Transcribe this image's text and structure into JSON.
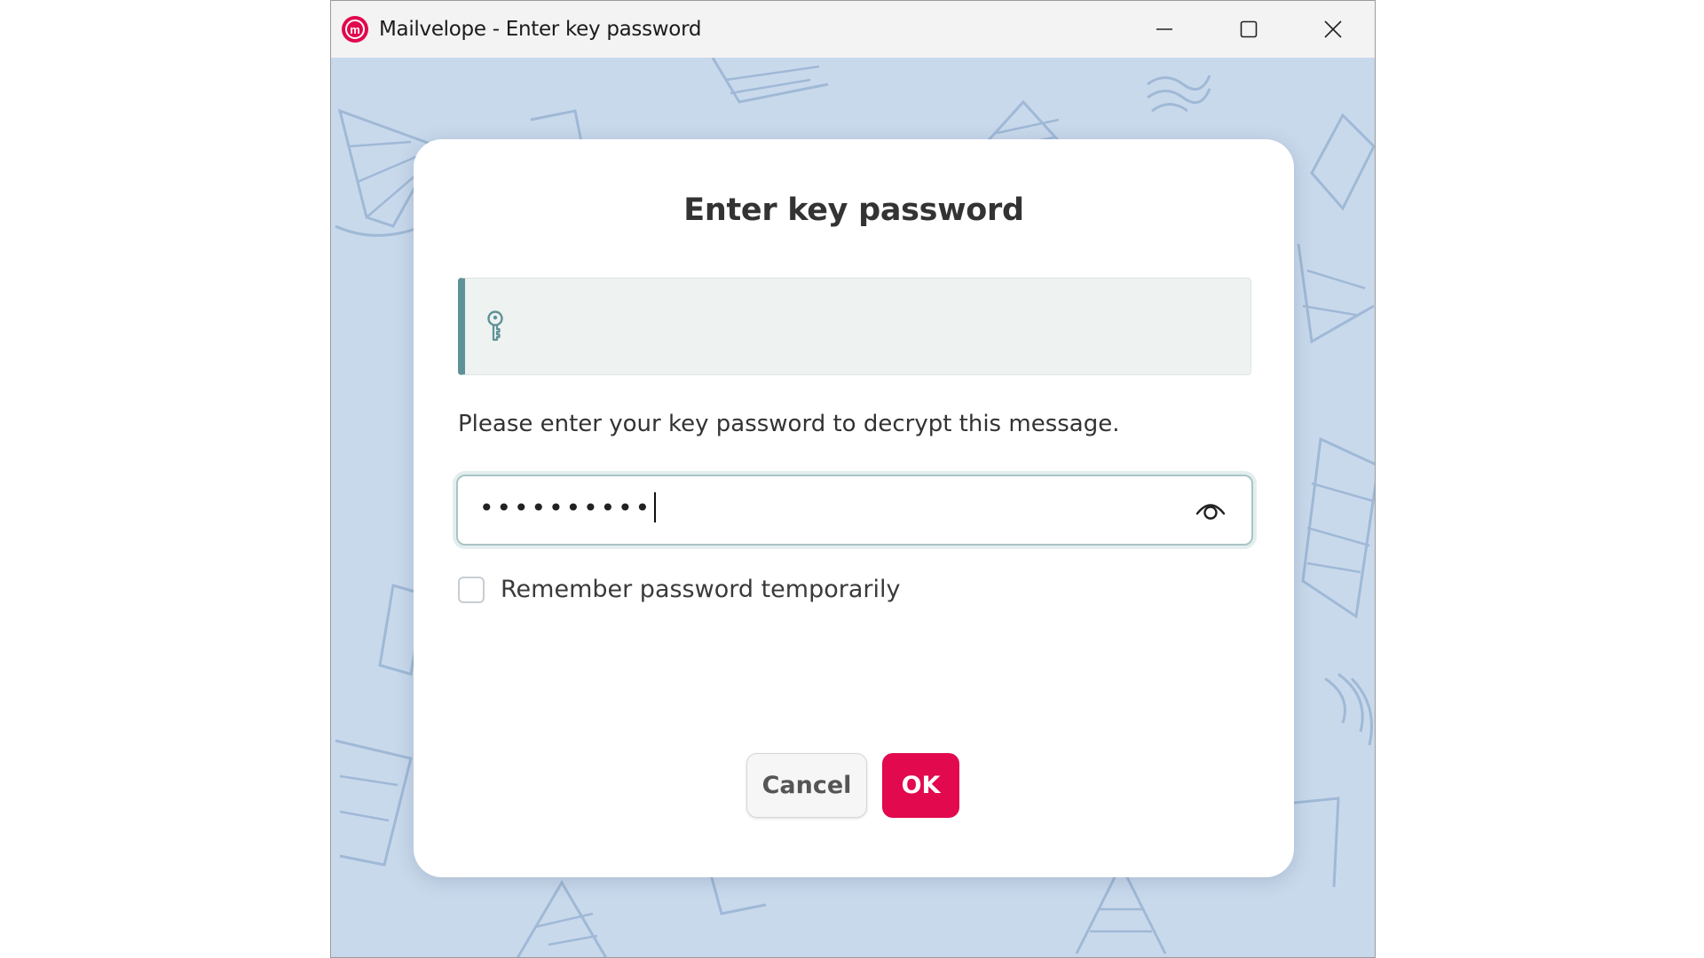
{
  "window": {
    "title": "Mailvelope - Enter key password",
    "app_icon": "mailvelope-logo",
    "logo_letter": "m",
    "controls": [
      "minimize-icon",
      "maximize-icon",
      "close-icon"
    ]
  },
  "dialog": {
    "title": "Enter key password",
    "key_info": {
      "icon": "key-icon",
      "text": ""
    },
    "prompt": "Please enter your key password to decrypt this message.",
    "password": {
      "value_masked": "••••••••••",
      "reveal_icon": "eye-icon"
    },
    "remember": {
      "label": "Remember password temporarily",
      "checked": false
    },
    "buttons": {
      "cancel": "Cancel",
      "ok": "OK"
    }
  },
  "colors": {
    "accent": "#e2094e",
    "background_pattern": "#c9d9ec",
    "key_info_border": "#5f9296"
  }
}
